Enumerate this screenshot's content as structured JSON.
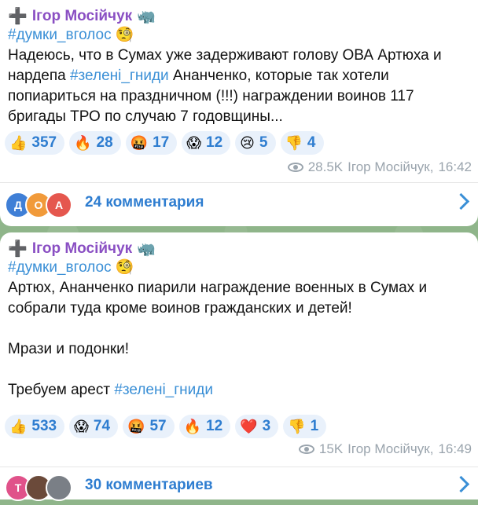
{
  "posts": [
    {
      "author": "Ігор Мосійчук",
      "author_prefix": "➕",
      "author_suffix": "🦏",
      "hashtag": "#думки_вголос",
      "hashtag_emoji": "🧐",
      "lines": [
        [
          "Надеюсь, что в Сумах уже задерживают голову ОВА Артюха и"
        ],
        [
          "нардепа ",
          "#зелені_гниди",
          " Ананченко, которые так хотели"
        ],
        [
          "попиариться на праздничном (!!!) награждении воинов 117"
        ],
        [
          "бригады ТРО по случаю 7 годовщины..."
        ]
      ],
      "reactions": [
        {
          "emoji": "👍",
          "count": "357"
        },
        {
          "emoji": "🔥",
          "count": "28"
        },
        {
          "emoji": "🤬",
          "count": "17"
        },
        {
          "emoji": "😱",
          "count": "12"
        },
        {
          "emoji": "😢",
          "count": "5"
        },
        {
          "emoji": "👎",
          "count": "4"
        }
      ],
      "views": "28.5K",
      "meta_author": "Ігор Мосійчук",
      "time": "16:42",
      "avatars": [
        {
          "letter": "Д",
          "color": "#3f7fd6"
        },
        {
          "letter": "О",
          "color": "#f19a3a"
        },
        {
          "letter": "А",
          "color": "#e5574e"
        }
      ],
      "comments": "24 комментария"
    },
    {
      "author": "Ігор Мосійчук",
      "author_prefix": "➕",
      "author_suffix": "🦏",
      "hashtag": "#думки_вголос",
      "hashtag_emoji": "🧐",
      "lines": [
        [
          "Артюх, Ананченко пиарили награждение военных в Сумах и"
        ],
        [
          "собрали туда кроме воинов гражданских и детей!"
        ],
        [
          ""
        ],
        [
          "Мрази и подонки!"
        ],
        [
          ""
        ],
        [
          "Требуем арест ",
          "#зелені_гниди"
        ]
      ],
      "reactions": [
        {
          "emoji": "👍",
          "count": "533"
        },
        {
          "emoji": "😱",
          "count": "74"
        },
        {
          "emoji": "🤬",
          "count": "57"
        },
        {
          "emoji": "🔥",
          "count": "12"
        },
        {
          "emoji": "❤️",
          "count": "3"
        },
        {
          "emoji": "👎",
          "count": "1"
        }
      ],
      "views": "15K",
      "meta_author": "Ігор Мосійчук",
      "time": "16:49",
      "avatars": [
        {
          "letter": "Т",
          "color": "#e0528a"
        },
        {
          "letter": "",
          "color": "#6b4a3a"
        },
        {
          "letter": "",
          "color": "#7a7f86"
        }
      ],
      "comments": "30 комментариев"
    }
  ]
}
